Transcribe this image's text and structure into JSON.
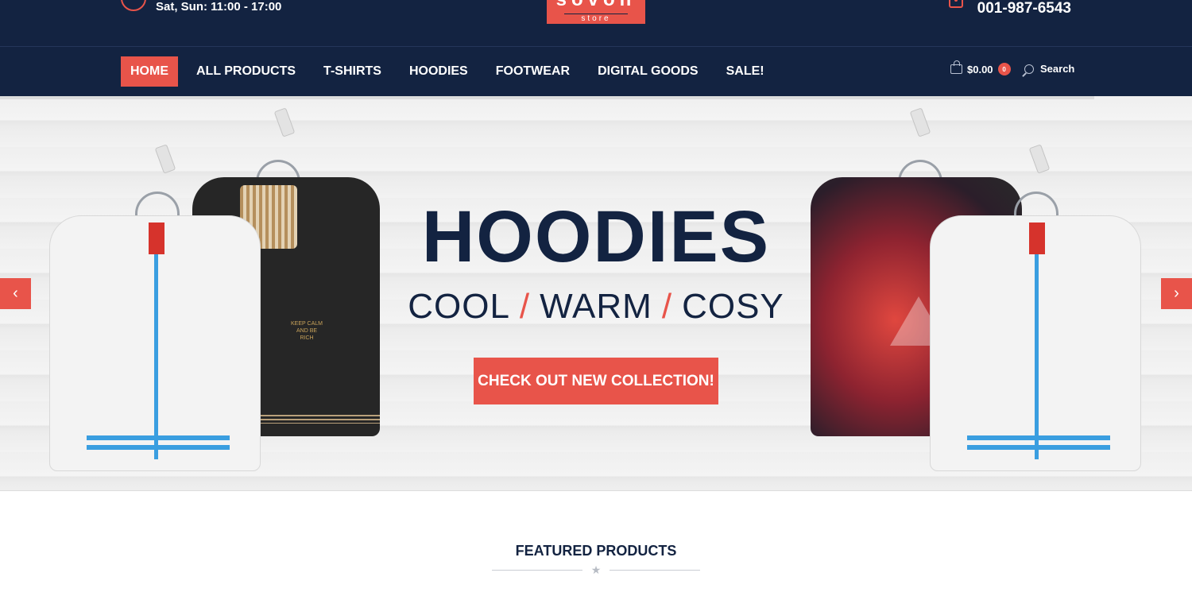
{
  "header": {
    "hours_text": "Sat, Sun: 11:00 - 17:00",
    "logo_text": "sovoh",
    "logo_subtext": "store",
    "phone": "001-987-6543"
  },
  "nav": {
    "items": [
      {
        "label": "HOME",
        "active": true
      },
      {
        "label": "ALL PRODUCTS"
      },
      {
        "label": "T-SHIRTS"
      },
      {
        "label": "HOODIES"
      },
      {
        "label": "FOOTWEAR"
      },
      {
        "label": "DIGITAL GOODS"
      },
      {
        "label": "SALE!"
      }
    ],
    "cart_total": "$0.00",
    "cart_count": "0",
    "search_label": "Search"
  },
  "hero": {
    "headline": "HOODIES",
    "sub_1": "COOL",
    "sub_2": "WARM",
    "sub_3": "COSY",
    "separator": "/",
    "cta": "CHECK OUT NEW COLLECTION!",
    "hoodie_print": "KEEP CALM AND BE RICH"
  },
  "featured": {
    "title": "FEATURED PRODUCTS"
  },
  "colors": {
    "navy": "#132341",
    "accent": "#e8544a"
  },
  "icons": [
    "clock-icon",
    "phone-icon",
    "bag-icon",
    "search-icon",
    "chevron-left-icon",
    "chevron-right-icon",
    "star-icon"
  ]
}
